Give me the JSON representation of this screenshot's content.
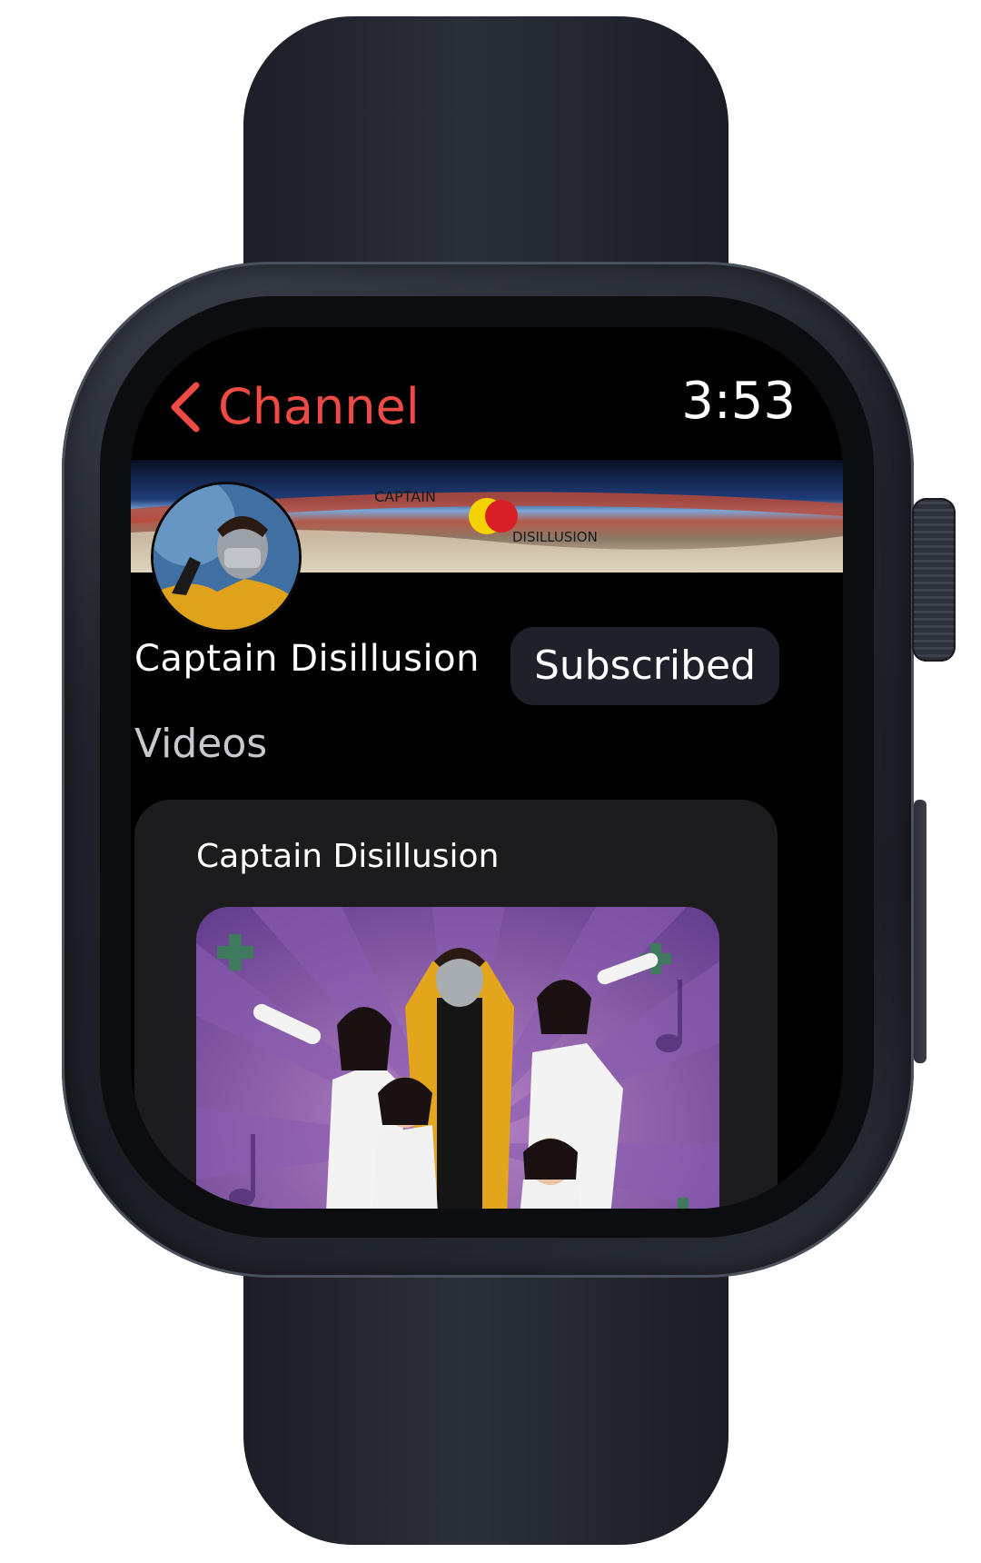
{
  "header": {
    "back_label": "Channel",
    "time": "3:53"
  },
  "banner": {
    "word_top": "CAPTAIN",
    "word_bottom": "DISILLUSION"
  },
  "channel": {
    "name": "Captain Disillusion",
    "subscribe_label": "Subscribed"
  },
  "videos": {
    "section_title": "Videos",
    "items": [
      {
        "title": "Captain Disillusion"
      }
    ]
  },
  "colors": {
    "accent": "#ef4b45",
    "screen_background": "#000000",
    "card_background": "#1c1c1e",
    "button_background": "#1e2129"
  },
  "icons": {
    "back": "chevron-left-icon"
  }
}
